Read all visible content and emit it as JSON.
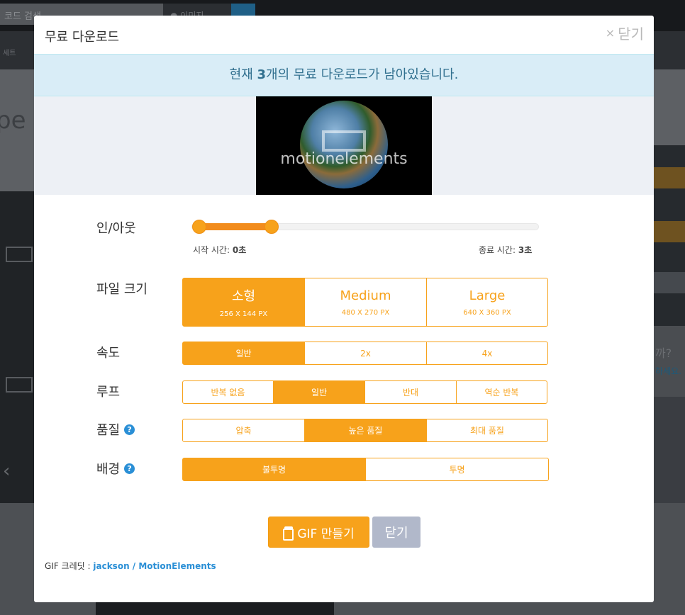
{
  "background": {
    "search_placeholder": "코드 검색",
    "search_button": "● 이미지",
    "nav_text": "세트",
    "title_fragment": "pe I",
    "right_text": "까?",
    "right_link": "하세요."
  },
  "modal": {
    "title": "무료 다운로드",
    "close_label": "닫기",
    "close_symbol": "×",
    "alert": {
      "prefix": "현재 ",
      "count": "3",
      "suffix": "개의 무료 다운로드가 남아있습니다."
    },
    "preview": {
      "watermark": "motionelements"
    },
    "in_out": {
      "label": "인/아웃",
      "start_label": "시작 시간:",
      "start_value": "0초",
      "end_label": "종료 시간:",
      "end_value": "3초",
      "start_fraction": 0.02,
      "end_fraction": 0.23
    },
    "file_size": {
      "label": "파일 크기",
      "options": [
        {
          "name": "소형",
          "dims": "256 X 144 PX",
          "active": true
        },
        {
          "name": "Medium",
          "dims": "480 X 270 PX",
          "active": false
        },
        {
          "name": "Large",
          "dims": "640 X 360 PX",
          "active": false
        }
      ]
    },
    "speed": {
      "label": "속도",
      "options": [
        {
          "name": "일반",
          "active": true
        },
        {
          "name": "2x",
          "active": false
        },
        {
          "name": "4x",
          "active": false
        }
      ]
    },
    "loop": {
      "label": "루프",
      "options": [
        {
          "name": "반복 없음",
          "active": false
        },
        {
          "name": "일반",
          "active": true
        },
        {
          "name": "반대",
          "active": false
        },
        {
          "name": "역순 반복",
          "active": false
        }
      ]
    },
    "quality": {
      "label": "품질",
      "options": [
        {
          "name": "압축",
          "active": false
        },
        {
          "name": "높은 품질",
          "active": true
        },
        {
          "name": "최대 품질",
          "active": false
        }
      ]
    },
    "background_opt": {
      "label": "배경",
      "options": [
        {
          "name": "불투명",
          "active": true
        },
        {
          "name": "투명",
          "active": false
        }
      ]
    },
    "buttons": {
      "make_gif": "GIF 만들기",
      "close": "닫기"
    },
    "credit": {
      "label": "GIF 크레딧 :",
      "author": "jackson / MotionElements"
    }
  },
  "colors": {
    "accent": "#f7a21b",
    "alert_bg": "#d9edf7",
    "alert_text": "#31708f",
    "link": "#2a8fd6",
    "close_btn": "#b1b8ca"
  },
  "icons": [
    "close-icon",
    "help-icon",
    "gif-file-icon"
  ]
}
